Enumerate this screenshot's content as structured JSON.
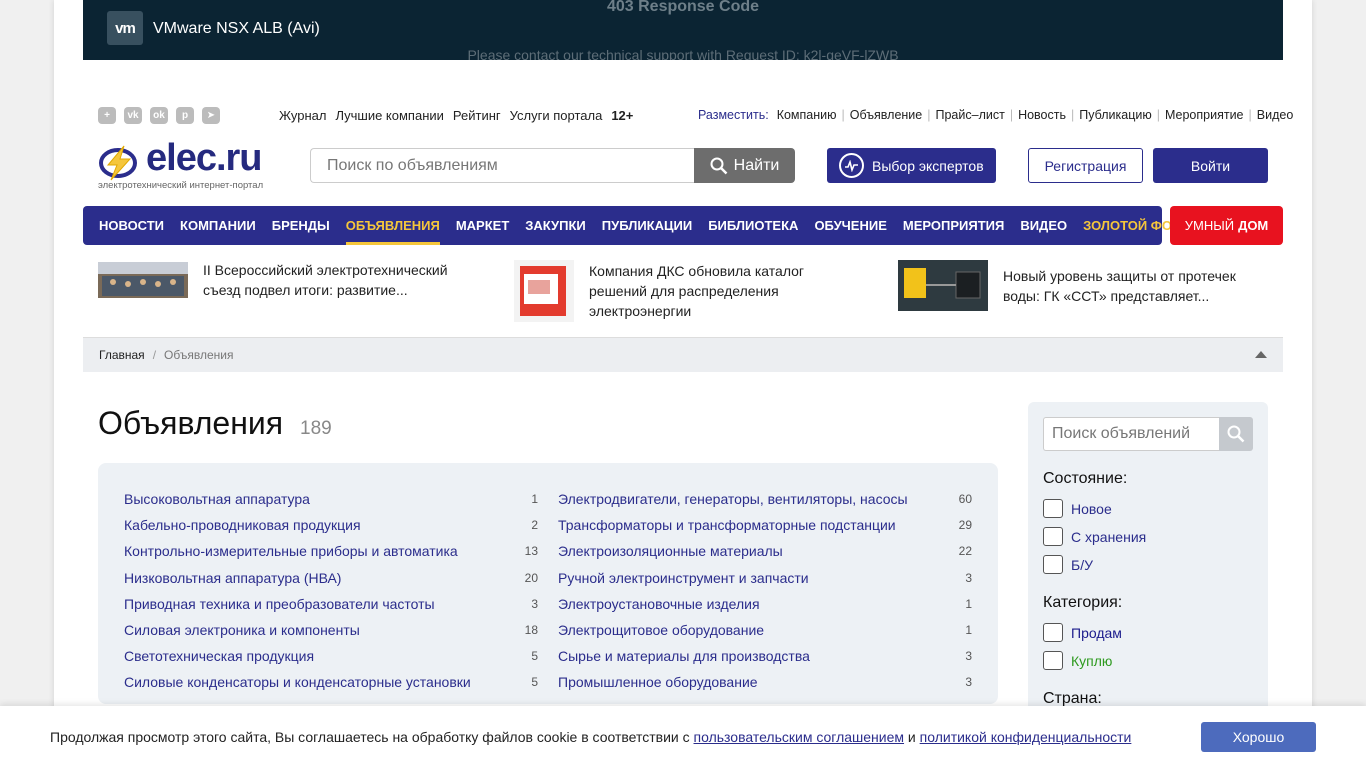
{
  "banner": {
    "logo": "vm",
    "title": "VMware NSX ALB (Avi)",
    "error_title": "403 Response Code",
    "error_text": "Please contact our technical support with Request ID: k2l-qeVF-lZWB"
  },
  "socials": [
    "plus-icon",
    "vk-icon",
    "ok-icon",
    "pinterest-icon",
    "telegram-icon"
  ],
  "top_links": [
    "Журнал",
    "Лучшие компании",
    "Рейтинг",
    "Услуги портала"
  ],
  "age": "12+",
  "place": {
    "label": "Разместить:",
    "items": [
      "Компанию",
      "Объявление",
      "Прайс–лист",
      "Новость",
      "Публикацию",
      "Мероприятие",
      "Видео"
    ]
  },
  "logo": {
    "word": "elec.ru",
    "subtitle": "электротехнический интернет-портал"
  },
  "search": {
    "placeholder": "Поиск по объявлениям",
    "button": "Найти"
  },
  "experts": "Выбор экспертов",
  "register": "Регистрация",
  "login": "Войти",
  "nav": [
    "НОВОСТИ",
    "КОМПАНИИ",
    "БРЕНДЫ",
    "ОБЪЯВЛЕНИЯ",
    "МАРКЕТ",
    "ЗАКУПКИ",
    "ПУБЛИКАЦИИ",
    "БИБЛИОТЕКА",
    "ОБУЧЕНИЕ",
    "МЕРОПРИЯТИЯ",
    "ВИДЕО",
    "ЗОЛОТОЙ ФОТОН"
  ],
  "smart": {
    "a": "УМНЫЙ",
    "b": "ДОМ"
  },
  "news": [
    "II Всероссийский электротехнический съезд подвел итоги: развитие...",
    "Компания ДКС обновила каталог решений для распределения электроэнергии",
    "Новый уровень защиты от протечек воды: ГК «ССТ» представляет..."
  ],
  "breadcrumb": {
    "home": "Главная",
    "sep": "/",
    "current": "Объявления"
  },
  "page": {
    "title": "Объявления",
    "count": "189"
  },
  "categories_left": [
    {
      "name": "Высоковольтная аппаратура",
      "count": "1"
    },
    {
      "name": "Кабельно-проводниковая продукция",
      "count": "2"
    },
    {
      "name": "Контрольно-измерительные приборы и автоматика",
      "count": "13"
    },
    {
      "name": "Низковольтная аппаратура (НВА)",
      "count": "20"
    },
    {
      "name": "Приводная техника и преобразователи частоты",
      "count": "3"
    },
    {
      "name": "Силовая электроника и компоненты",
      "count": "18"
    },
    {
      "name": "Светотехническая продукция",
      "count": "5"
    },
    {
      "name": "Силовые конденсаторы и конденсаторные установки",
      "count": "5"
    }
  ],
  "categories_right": [
    {
      "name": "Электродвигатели, генераторы, вентиляторы, насосы",
      "count": "60"
    },
    {
      "name": "Трансформаторы и трансформаторные подстанции",
      "count": "29"
    },
    {
      "name": "Электроизоляционные материалы",
      "count": "22"
    },
    {
      "name": "Ручной электроинструмент и запчасти",
      "count": "3"
    },
    {
      "name": "Электроустановочные изделия",
      "count": "1"
    },
    {
      "name": "Электрощитовое оборудование",
      "count": "1"
    },
    {
      "name": "Сырье и материалы для производства",
      "count": "3"
    },
    {
      "name": "Промышленное оборудование",
      "count": "3"
    }
  ],
  "sidebar": {
    "search_placeholder": "Поиск объявлений",
    "state_title": "Состояние:",
    "states": [
      "Новое",
      "С хранения",
      "Б/У"
    ],
    "category_title": "Категория:",
    "sell": "Продам",
    "buy": "Куплю",
    "country_title": "Страна:"
  },
  "cookie": {
    "text": "Продолжая просмотр этого сайта, Вы соглашаетесь на обработку файлов cookie в соответствии с",
    "link1": "пользовательским соглашением",
    "and": "и",
    "link2": "политикой конфиденциальности",
    "ok": "Хорошо"
  },
  "colors": {
    "brand": "#2b2d8c",
    "accent": "#f5c63b",
    "smart": "#e8121f",
    "sell": "#1a1a8c",
    "buy": "#2e9a1f"
  }
}
